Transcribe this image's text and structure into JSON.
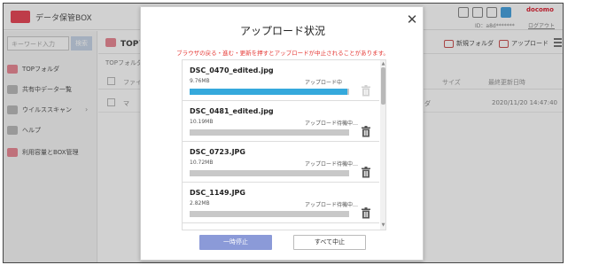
{
  "app": {
    "logo_text": "データ保管BOX",
    "carrier": "docomo",
    "user_id": "ID：a8d*******",
    "logout_label": "ログアウト"
  },
  "sidebar": {
    "search_placeholder": "キーワード入力",
    "search_button": "検索",
    "items": [
      {
        "label": "TOPフォルダ",
        "icon": "folder-icon"
      },
      {
        "label": "共有中データ一覧",
        "icon": "share-icon"
      },
      {
        "label": "ウイルススキャン",
        "icon": "shield-icon"
      },
      {
        "label": "ヘルプ",
        "icon": "help-icon"
      },
      {
        "label": "利用容量とBOX管理",
        "icon": "storage-icon"
      }
    ]
  },
  "main": {
    "crumb_title": "TOPフ",
    "sub_crumb": "TOPフォルダ",
    "actions": {
      "new_folder": "新規フォルダ",
      "upload": "アップロード"
    },
    "columns": {
      "name": "ファイ",
      "size": "サイズ",
      "updated": "最終更新日時"
    },
    "rows": [
      {
        "name": "マ",
        "type": "ダ",
        "updated": "2020/11/20 14:47:40"
      }
    ]
  },
  "modal": {
    "title": "アップロード状況",
    "warning": "ブラウザの戻る・進む・更新を押すとアップロードが中止されることがあります。",
    "items": [
      {
        "name": "DSC_0470_edited.jpg",
        "size": "9.76MB",
        "status": "アップロード中",
        "progress": 0.99
      },
      {
        "name": "DSC_0481_edited.jpg",
        "size": "10.19MB",
        "status": "アップロード待機中…",
        "progress": 0
      },
      {
        "name": "DSC_0723.JPG",
        "size": "10.72MB",
        "status": "アップロード待機中…",
        "progress": 0
      },
      {
        "name": "DSC_1149.JPG",
        "size": "2.82MB",
        "status": "アップロード待機中…",
        "progress": 0
      }
    ],
    "pause_label": "一時停止",
    "cancel_all_label": "すべて中止"
  },
  "colors": {
    "progress": "#35a9dc",
    "pause_button": "#8b9ad8",
    "warning": "#e53935",
    "brand": "#e84a5a"
  }
}
